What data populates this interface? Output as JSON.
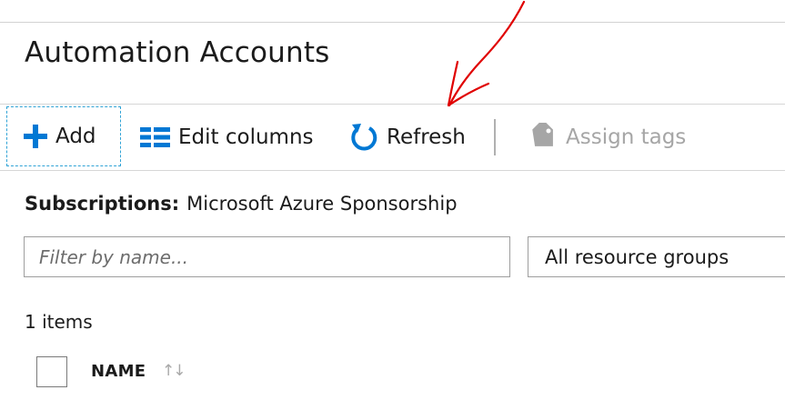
{
  "page": {
    "title": "Automation Accounts"
  },
  "toolbar": {
    "add_label": "Add",
    "edit_columns_label": "Edit columns",
    "refresh_label": "Refresh",
    "assign_tags_label": "Assign tags"
  },
  "subscriptions": {
    "label": "Subscriptions:",
    "value": "Microsoft Azure Sponsorship"
  },
  "filter": {
    "placeholder": "Filter by name..."
  },
  "resource_groups": {
    "selected": "All resource groups"
  },
  "list": {
    "count_text": "1 items",
    "columns": [
      {
        "header": "NAME",
        "sort_icon": "↑↓"
      }
    ]
  },
  "colors": {
    "accent": "#0078d4",
    "focus_outline": "#30a3d6",
    "disabled": "#a6a6a6",
    "annotation": "#e00000"
  },
  "icons": {
    "add": "plus-icon",
    "edit_columns": "columns-icon",
    "refresh": "refresh-icon",
    "assign_tags": "tag-icon",
    "sort": "sort-icon"
  }
}
